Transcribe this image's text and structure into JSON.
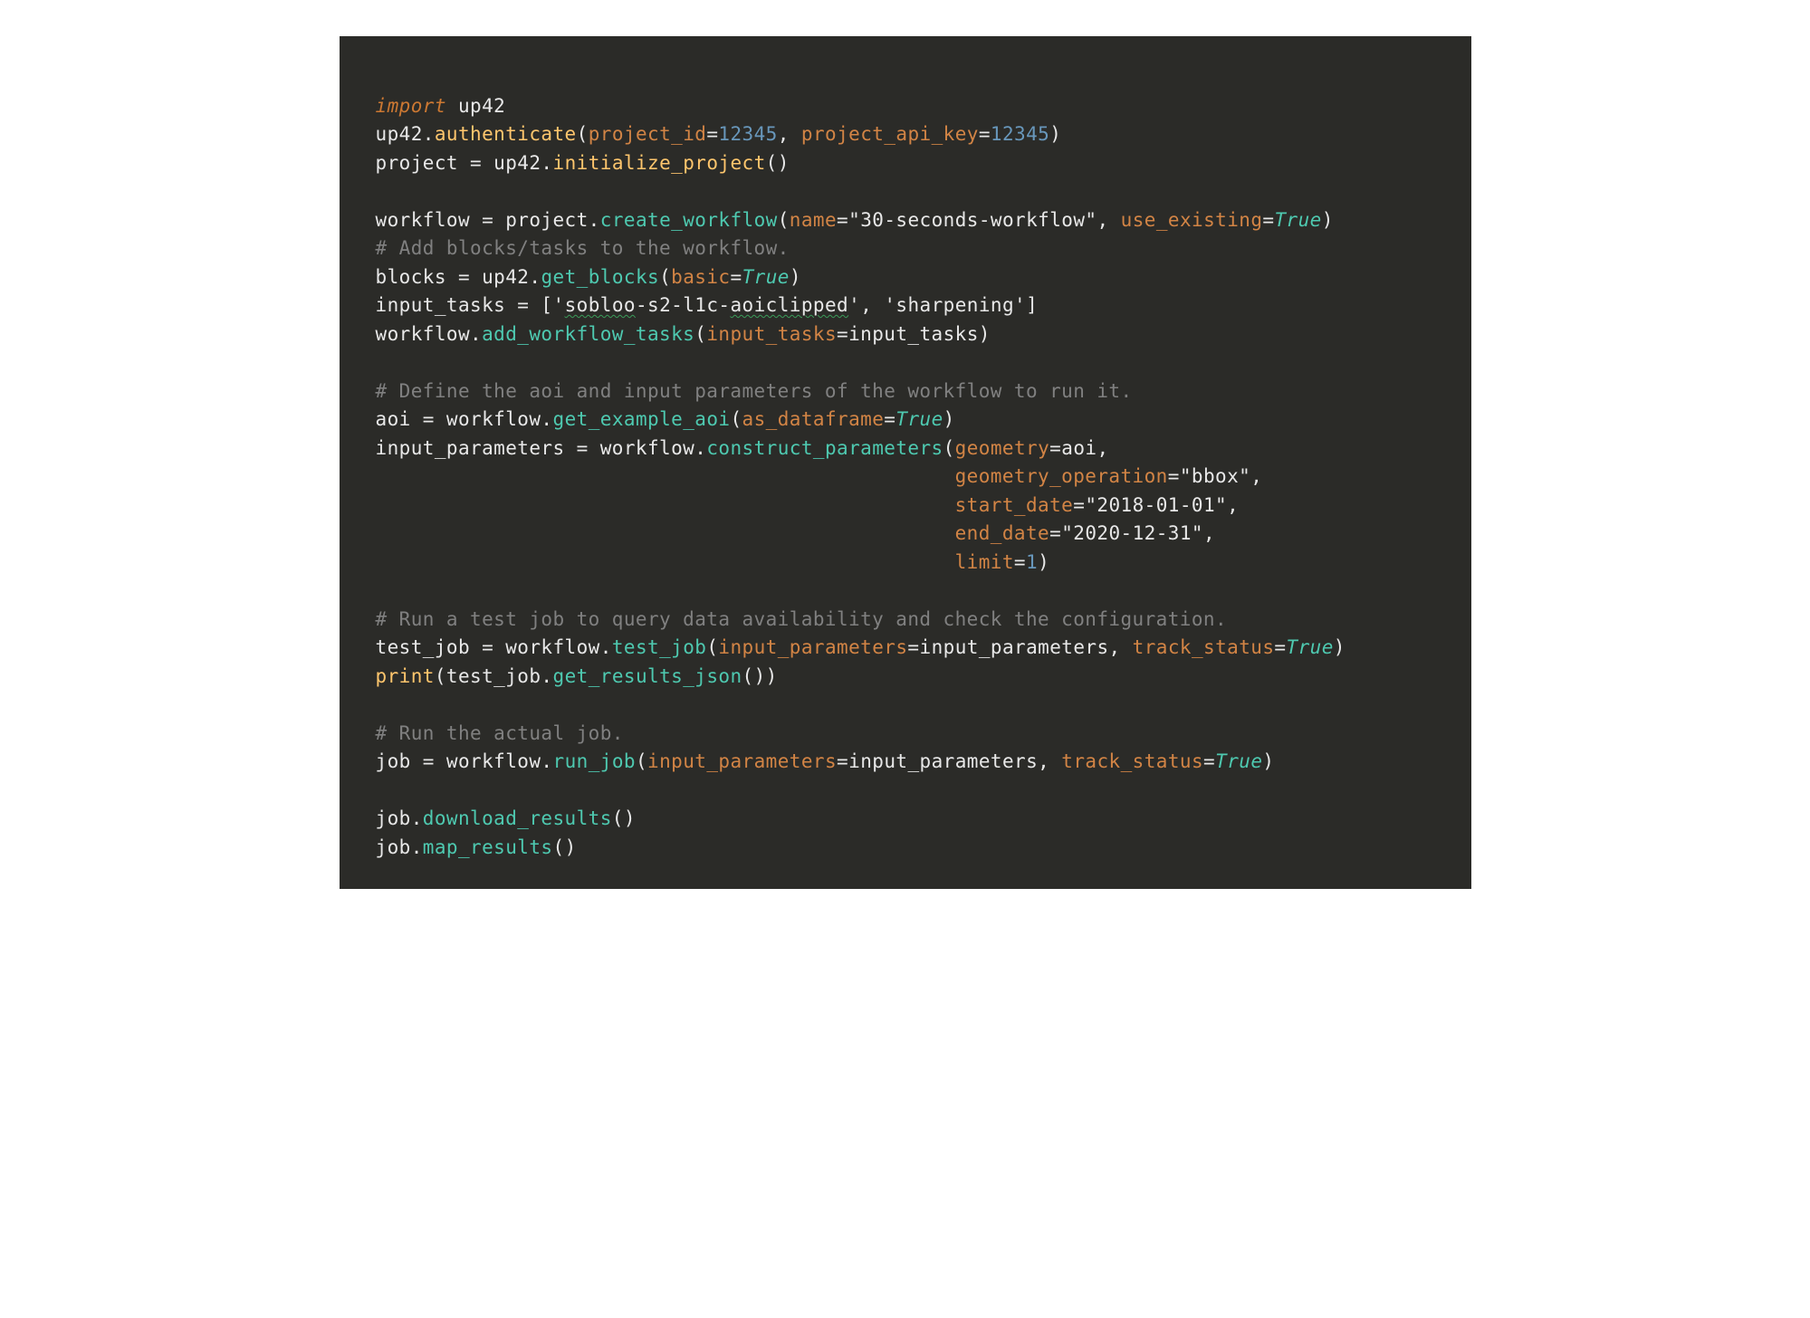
{
  "code": {
    "l1": {
      "import": "import",
      "sp": " ",
      "mod": "up42"
    },
    "l2": {
      "mod": "up42",
      "dot": ".",
      "fn": "authenticate",
      "op": "(",
      "p1": "project_id",
      "eq": "=",
      "v1": "12345",
      "c": ", ",
      "p2": "project_api_key",
      "v2": "12345",
      "cp": ")"
    },
    "l3": {
      "lhs": "project ",
      "eq": "= ",
      "mod": "up42",
      "dot": ".",
      "fn": "initialize_project",
      "op": "(",
      "cp": ")"
    },
    "l4": "",
    "l5": {
      "lhs": "workflow ",
      "eq": "= ",
      "obj": "project",
      "dot": ".",
      "fn": "create_workflow",
      "op": "(",
      "p1": "name",
      "e1": "=",
      "q1": "\"",
      "s1": "30-seconds-workflow",
      "q2": "\"",
      "c": ", ",
      "p2": "use_existing",
      "e2": "=",
      "v2": "True",
      "cp": ")"
    },
    "l6": {
      "comment": "# Add blocks/tasks to the workflow."
    },
    "l7": {
      "lhs": "blocks ",
      "eq": "= ",
      "obj": "up42",
      "dot": ".",
      "fn": "get_blocks",
      "op": "(",
      "p1": "basic",
      "e1": "=",
      "v1": "True",
      "cp": ")"
    },
    "l8": {
      "lhs": "input_tasks ",
      "eq": "= ",
      "ob": "[",
      "q1": "'",
      "s1a": "sobloo",
      "s1b": "-s2-l1c-",
      "s1c": "aoiclipped",
      "q2": "'",
      "c": ", ",
      "q3": "'",
      "s2": "sharpening",
      "q4": "'",
      "cb": "]"
    },
    "l9": {
      "obj": "workflow",
      "dot": ".",
      "fn": "add_workflow_tasks",
      "op": "(",
      "p1": "input_tasks",
      "e1": "=",
      "v1": "input_tasks",
      "cp": ")"
    },
    "l10": "",
    "l11": {
      "comment": "# Define the aoi and input parameters of the workflow to run it."
    },
    "l12": {
      "lhs": "aoi ",
      "eq": "= ",
      "obj": "workflow",
      "dot": ".",
      "fn": "get_example_aoi",
      "op": "(",
      "p1": "as_dataframe",
      "e1": "=",
      "v1": "True",
      "cp": ")"
    },
    "l13": {
      "lhs": "input_parameters ",
      "eq": "= ",
      "obj": "workflow",
      "dot": ".",
      "fn": "construct_parameters",
      "op": "(",
      "p1": "geometry",
      "e1": "=",
      "v1": "aoi",
      "c": ","
    },
    "l14": {
      "pad": "                                                 ",
      "p": "geometry_operation",
      "e": "=",
      "q1": "\"",
      "s": "bbox",
      "q2": "\"",
      "c": ","
    },
    "l15": {
      "pad": "                                                 ",
      "p": "start_date",
      "e": "=",
      "q1": "\"",
      "s": "2018-01-01",
      "q2": "\"",
      "c": ","
    },
    "l16": {
      "pad": "                                                 ",
      "p": "end_date",
      "e": "=",
      "q1": "\"",
      "s": "2020-12-31",
      "q2": "\"",
      "c": ","
    },
    "l17": {
      "pad": "                                                 ",
      "p": "limit",
      "e": "=",
      "v": "1",
      "cp": ")"
    },
    "l18": "",
    "l19": {
      "comment": "# Run a test job to query data availability and check the configuration."
    },
    "l20": {
      "lhs": "test_job ",
      "eq": "= ",
      "obj": "workflow",
      "dot": ".",
      "fn": "test_job",
      "op": "(",
      "p1": "input_parameters",
      "e1": "=",
      "v1": "input_parameters",
      "c": ", ",
      "p2": "track_status",
      "e2": "=",
      "v2": "True",
      "cp": ")"
    },
    "l21": {
      "fn": "print",
      "op": "(",
      "obj": "test_job",
      "dot": ".",
      "fn2": "get_results_json",
      "op2": "(",
      "cp2": ")",
      "cp": ")"
    },
    "l22": "",
    "l23": {
      "comment": "# Run the actual job."
    },
    "l24": {
      "lhs": "job ",
      "eq": "= ",
      "obj": "workflow",
      "dot": ".",
      "fn": "run_job",
      "op": "(",
      "p1": "input_parameters",
      "e1": "=",
      "v1": "input_parameters",
      "c": ", ",
      "p2": "track_status",
      "e2": "=",
      "v2": "True",
      "cp": ")"
    },
    "l25": "",
    "l26": {
      "obj": "job",
      "dot": ".",
      "fn": "download_results",
      "op": "(",
      "cp": ")"
    },
    "l27": {
      "obj": "job",
      "dot": ".",
      "fn": "map_results",
      "op": "(",
      "cp": ")"
    }
  }
}
